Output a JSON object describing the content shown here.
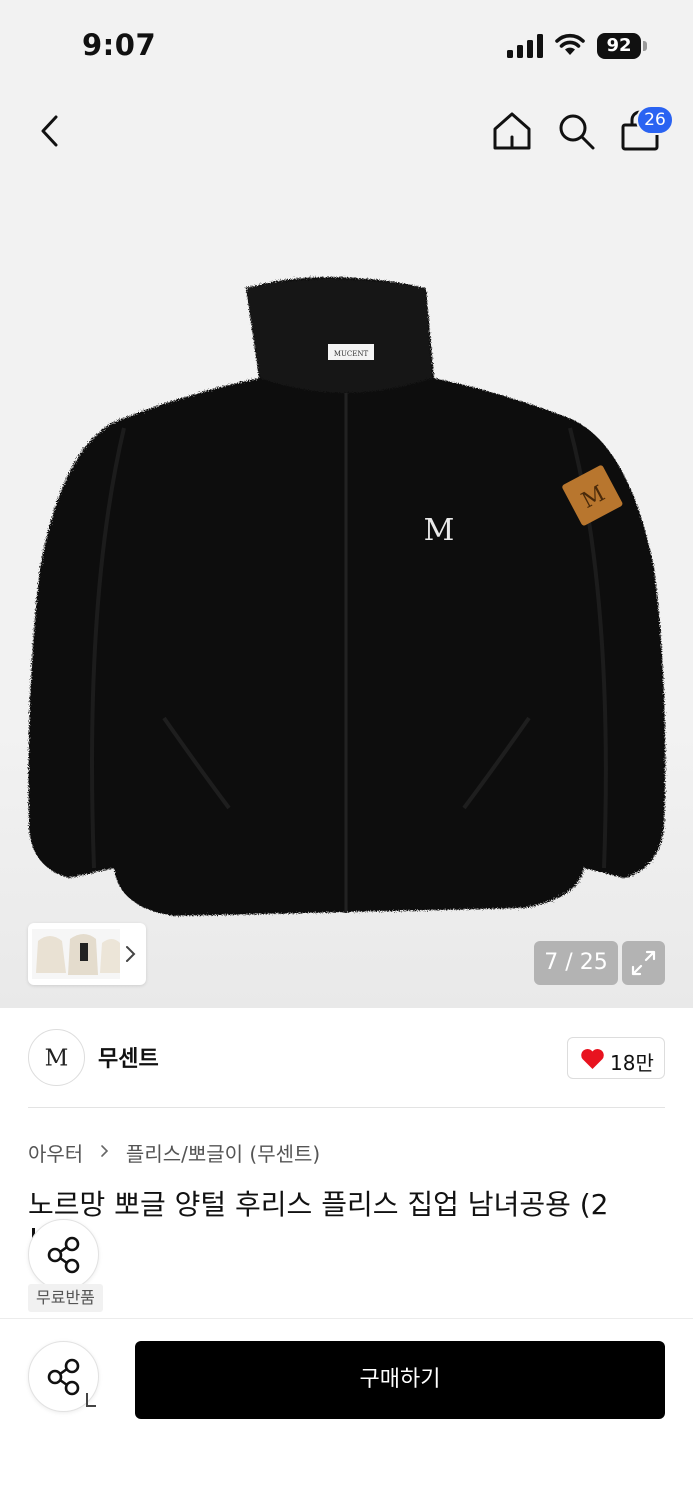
{
  "status_bar": {
    "time": "9:07",
    "battery": "92"
  },
  "nav": {
    "back_icon": "chevron-left-icon",
    "home_icon": "home-icon",
    "search_icon": "search-icon",
    "bag_icon": "shopping-bag-icon",
    "cart_count": "26",
    "badge_color": "#2a63f2"
  },
  "gallery": {
    "counter": "7 / 25",
    "expand_icon": "expand-icon",
    "thumb_chevron_icon": "chevron-right-icon",
    "label_text": "MUCENT",
    "logo_text": "M"
  },
  "brand": {
    "name": "무센트",
    "logo_text": "M",
    "like_icon": "heart-icon",
    "like_count": "18만",
    "heart_color": "#e8131f"
  },
  "breadcrumb": {
    "level1": "아우터",
    "level2": "플리스/뽀글이 (무센트)"
  },
  "product": {
    "title": "노르망 뽀글 양털 후리스 플리스 집업 남녀공용 (2",
    "tag": "무료반품"
  },
  "actions": {
    "share_icon": "share-icon",
    "buy_label": "구매하기"
  }
}
